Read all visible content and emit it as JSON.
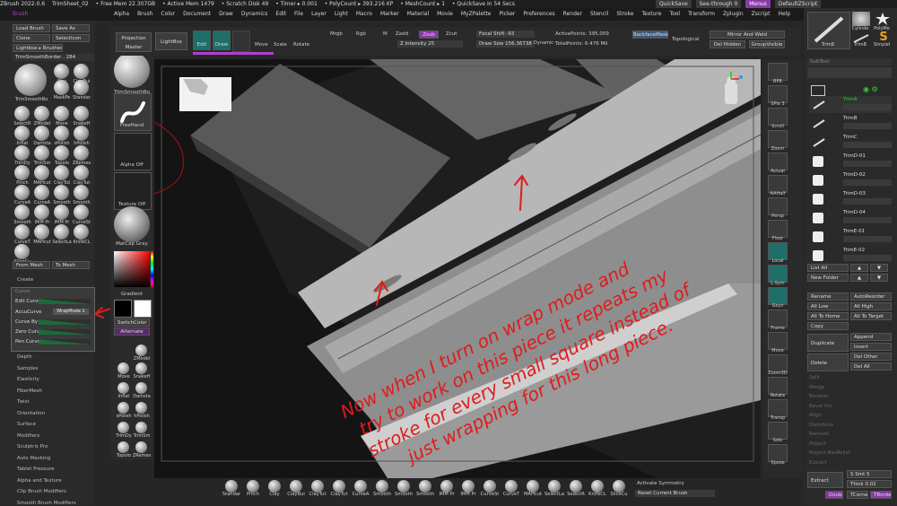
{
  "titlebar": {
    "app": "ZBrush 2022.0.6",
    "doc": "TrimSheet_02",
    "free_mem": "• Free Mem 22.307GB",
    "active_mem": "• Active Mem 1479",
    "scratch": "• Scratch Disk 49",
    "timer": "• Timer ▸ 0.001",
    "polycount": "• PolyCount ▸ 393.216 KP",
    "meshcount": "• MeshCount ▸ 1",
    "quicksave": "• QuickSave In 54 Secs",
    "quicksave_btn": "QuickSave",
    "see_through": "See-through 0",
    "menus_btn": "Menus",
    "script_btn": "DefaultZScript"
  },
  "menubar": {
    "left_label": "Brush",
    "items": [
      "Alpha",
      "Brush",
      "Color",
      "Document",
      "Draw",
      "Dynamics",
      "Edit",
      "File",
      "Layer",
      "Light",
      "Macro",
      "Marker",
      "Material",
      "Movie",
      "MyZPalette",
      "Picker",
      "Preferences",
      "Render",
      "Stencil",
      "Stroke",
      "Texture",
      "Tool",
      "Transform",
      "Zplugin",
      "Zscript",
      "Help"
    ]
  },
  "brush_palette": {
    "buttons": [
      "Load Brush",
      "Save As",
      "Clone",
      "SelectIcon",
      "Lightbox ▸ Brushes"
    ],
    "current_brush": "TrimSmoothBorder . 284",
    "current_name": "TrimSmoothBo",
    "grid": [
      [
        "Clay",
        "ClayBui"
      ],
      [
        "MaskPe",
        "Standar"
      ],
      [
        "SelectR",
        "ZModel",
        "Move",
        "SnakeH"
      ],
      [
        "Inflat",
        "Damsta",
        "sPolish",
        "hPolish"
      ],
      [
        "TrimDy",
        "TrimSm",
        "Topolo",
        "ZRemes"
      ],
      [
        "Pinch",
        "MAHcut",
        "ClayTut",
        "ClayTut"
      ],
      [
        "CurveA",
        "CurveA",
        "Smooth",
        "Smooth"
      ],
      [
        "Smooth",
        "IMM Pr",
        "IMM Pr",
        "CurveSt"
      ],
      [
        "CurveT",
        "MAHcut",
        "SelectLa",
        "KnifeCL"
      ],
      [
        "SliceCu"
      ]
    ],
    "from_mesh": "From Mesh",
    "to_mesh": "To Mesh"
  },
  "sublist": {
    "items": [
      "Create",
      "Depth",
      "Samples",
      "Elasticity",
      "FiberMesh",
      "Twist",
      "Orientation",
      "Surface",
      "Modifiers",
      "Sculptris Pro",
      "Auto Masking",
      "Tablet Pressure",
      "Alpha and Texture",
      "Clip Brush Modifiers",
      "Smooth Brush Modifiers"
    ]
  },
  "curve_panel": {
    "title": "Curve",
    "rows": [
      "Edit Curve",
      "AccuCurve",
      "Curve By Pen",
      "Zero Curve",
      "Pen Curve"
    ],
    "wrapmode": "WrapMode 1"
  },
  "left_shelf": {
    "brush": "TrimSmoothBo",
    "stroke": "FreeHand",
    "alpha": "Alpha Off",
    "texture": "Texture Off",
    "material": "MatCap Gray",
    "gradient": "Gradient",
    "switch_color": "SwitchColor",
    "alternate": "Alternate",
    "mini_brushes": [
      "ZModel",
      "Move",
      "SnakeH",
      "Inflat",
      "Damsta",
      "sPolish",
      "hPolish",
      "TrimDy",
      "TrimSm",
      "Topolo",
      "ZRemes"
    ]
  },
  "top_toolbar": {
    "projection_master": "Projection Master",
    "lightbox": "LightBox",
    "edit": "Edit",
    "draw": "Draw",
    "move": "Move",
    "scale": "Scale",
    "rotate": "Rotate",
    "mrgb": "Mrgb",
    "rgb": "Rgb",
    "m": "M",
    "zadd": "Zadd",
    "zsub": "Zsub",
    "zcut": "Zcut",
    "z_intensity": "Z Intensity 25",
    "focal_shift": "Focal Shift -93",
    "draw_size": "Draw Size 156.36738",
    "dynamic": "Dynamic",
    "active_points": "ActivePoints: 395,009",
    "total_points": "TotalPoints: 6.476 Mil",
    "backface_mask": "BackfaceMask",
    "topological": "Topological",
    "mirror_weld": "Mirror And Weld",
    "del_hidden": "Del Hidden",
    "group_visible": "GroupVisible"
  },
  "right_strip": {
    "labels": [
      "BPR",
      "SPix 3",
      "Scroll",
      "Zoom",
      "Actual",
      "AAHalf",
      "Persp",
      "Floor",
      "Local",
      "L.Sym",
      "Gxyz",
      "Frame",
      "Move",
      "Zoom3D",
      "Rotate",
      "Transp",
      "Solo",
      "Xpose"
    ]
  },
  "right_panel": {
    "tools_top": [
      "TrimB",
      "Cylinde",
      "PolyMe",
      "TrimB",
      "SimpleI"
    ],
    "subtool_header": "SubTool",
    "subtools": [
      "TrimA",
      "TrimB",
      "TrimC",
      "TrimD-01",
      "TrimD-02",
      "TrimD-03",
      "TrimD-04",
      "TrimE-01",
      "TrimE-02"
    ],
    "list_all": "List All",
    "new_folder": "New Folder",
    "rename": "Rename",
    "auto_reorder": "AutoReorder",
    "all_low": "All Low",
    "all_high": "All High",
    "all_to_home": "All To Home",
    "all_to_target": "All To Target",
    "copy": "Copy",
    "duplicate": "Duplicate",
    "append": "Append",
    "insert": "Insert",
    "delete": "Delete",
    "del_other": "Del Other",
    "del_all": "Del All",
    "gray_items": [
      "Split",
      "Merge",
      "Boolean",
      "Bevel Pro",
      "Align",
      "Distribute",
      "Remesh",
      "Project",
      "Project BasRelief",
      "Extract"
    ],
    "extract": "Extract",
    "s_smt": "S Smt 5",
    "thick": "Thick 0.02",
    "double": "Double",
    "tcorne": "TCorne",
    "tborde": "TBorde"
  },
  "bottom_shelf": {
    "brushes": [
      "Standar",
      "Pinch",
      "Clay",
      "ClayBui",
      "ClayTut",
      "ClayTut",
      "CurveA",
      "Smooth",
      "Smooth",
      "Smooth",
      "IMM Pr",
      "IMM Pr",
      "CurveSt",
      "CurveT",
      "MAHcut",
      "SelectLa",
      "SelectR",
      "KnifeCL",
      "SliceCu"
    ],
    "activate_symmetry": "Activate Symmetry",
    "reset_brush": "Reset Current Brush"
  },
  "annotation": {
    "lines": [
      "Now when I turn on wrap mode and",
      "try to work on this piece it repeats my",
      "stroke for every small square instead of",
      "just wrapping for this long piece."
    ],
    "color": "#e11b1b"
  },
  "colors": {
    "accent_purple": "#b03fd0",
    "accent_teal": "#33b6b0",
    "bg": "#262626",
    "annotation_red": "#e11b1b"
  }
}
